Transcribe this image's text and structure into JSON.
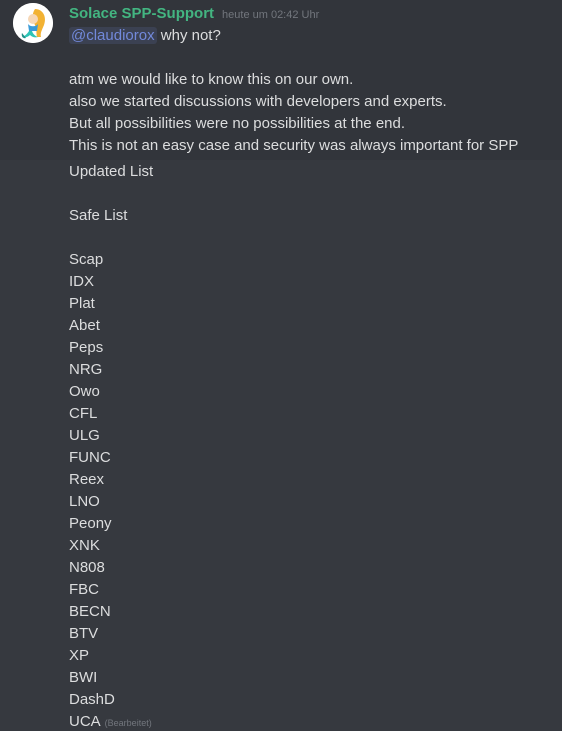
{
  "message1": {
    "username": "Solace SPP-Support",
    "timestamp": "heute um 02:42 Uhr",
    "mention": "@claudiorox",
    "reply": " why not?",
    "lines": [
      "atm we would like to know this on our own.",
      "also we started discussions with developers and experts.",
      "But all possibilities were no possibilities at the end.",
      "This is not an easy case and security was always important for SPP"
    ]
  },
  "message2": {
    "heading": "Updated List",
    "subheading": "Safe List",
    "items": [
      "Scap",
      "IDX",
      "Plat",
      "Abet",
      "Peps",
      "NRG",
      "Owo",
      "CFL",
      "ULG",
      "FUNC",
      "Reex",
      "LNO",
      "Peony",
      "XNK",
      "N808",
      "FBC",
      "BECN",
      "BTV",
      "XP",
      "BWI",
      "DashD"
    ],
    "last_item": "UCA",
    "edited_label": "(Bearbeitet)"
  }
}
